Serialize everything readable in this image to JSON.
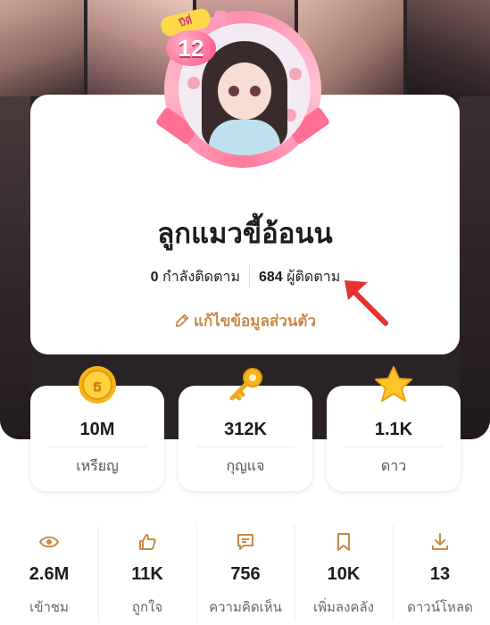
{
  "profile": {
    "username": "ลูกแมวขี้อ้อนน",
    "badge_label": "ปีที่",
    "badge_number": "12",
    "following_count": "0",
    "following_label": "กำลังติดตาม",
    "followers_count": "684",
    "followers_label": "ผู้ติดตาม",
    "edit_label": "แก้ไขข้อมูลส่วนตัว"
  },
  "currencies": [
    {
      "icon": "coin-icon",
      "value": "10M",
      "label": "เหรียญ"
    },
    {
      "icon": "key-icon",
      "value": "312K",
      "label": "กุญแจ"
    },
    {
      "icon": "star-icon",
      "value": "1.1K",
      "label": "ดาว"
    }
  ],
  "stats": [
    {
      "icon": "eye-icon",
      "value": "2.6M",
      "label": "เข้าชม"
    },
    {
      "icon": "thumbs-up-icon",
      "value": "11K",
      "label": "ถูกใจ"
    },
    {
      "icon": "comment-icon",
      "value": "756",
      "label": "ความคิดเห็น"
    },
    {
      "icon": "bookmark-icon",
      "value": "10K",
      "label": "เพิ่มลงคลัง"
    },
    {
      "icon": "download-icon",
      "value": "13",
      "label": "ดาวน์โหลด"
    }
  ],
  "colors": {
    "accent": "#c98a48",
    "arrow": "#e5322e",
    "cover": "#2a2326"
  }
}
